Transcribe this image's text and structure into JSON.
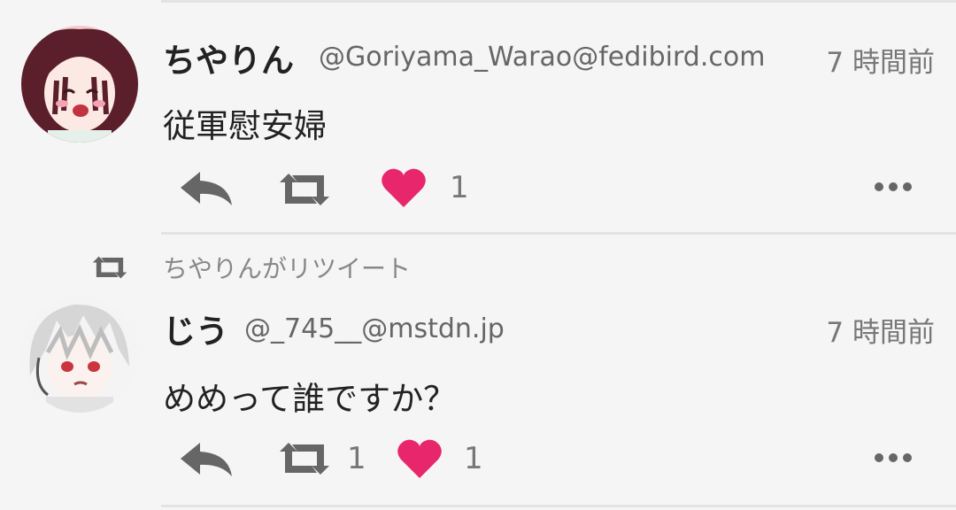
{
  "posts": [
    {
      "display_name": "ちやりん",
      "handle": "@Goriyama_Warao@fedibird.com",
      "time": "7 時間前",
      "content": "従軍慰安婦",
      "boost_count": "",
      "fav_count": "1"
    },
    {
      "display_name": "じう",
      "handle": "@_745__@mstdn.jp",
      "time": "7 時間前",
      "content": "めめって誰ですか？",
      "boost_count": "1",
      "fav_count": "1"
    }
  ],
  "retweet_notice": "ちやりんがリツイート",
  "colors": {
    "heart": "#e8266b",
    "icon_gray": "#666666",
    "divider": "#e3e3e3",
    "background": "#f5f5f5"
  },
  "icons": {
    "reply": "reply-icon",
    "boost": "boost-icon",
    "favourite": "heart-icon",
    "more": "more-icon"
  }
}
